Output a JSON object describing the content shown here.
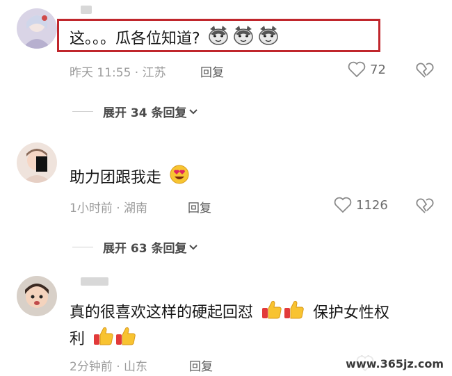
{
  "comments": [
    {
      "text": "这。。。瓜各位知道?",
      "time_location": "昨天 11:55 · 江苏",
      "reply_label": "回复",
      "likes": "72",
      "expand_label": "展开 34 条回复"
    },
    {
      "text": "助力团跟我走",
      "time_location": "1小时前 · 湖南",
      "reply_label": "回复",
      "likes": "1126",
      "expand_label": "展开 63 条回复"
    },
    {
      "text_line1_a": "真的很喜欢这样的硬起回怼",
      "text_line1_b": "保护女性权",
      "text_line2": "利",
      "time_location": "2分钟前 · 山东",
      "reply_label": "回复"
    }
  ],
  "watermark": "www.365jz.com",
  "colors": {
    "highlight_border": "#c0262c",
    "meta_text": "#9b9b9b"
  }
}
